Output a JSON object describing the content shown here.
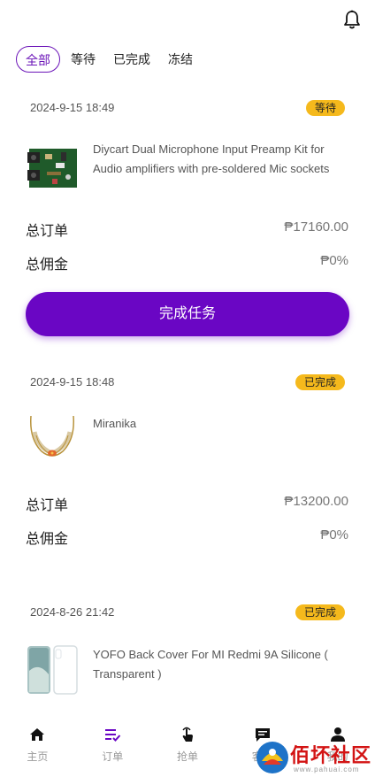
{
  "tabs": [
    {
      "label": "全部",
      "active": true
    },
    {
      "label": "等待",
      "active": false
    },
    {
      "label": "已完成",
      "active": false
    },
    {
      "label": "冻结",
      "active": false
    }
  ],
  "orders": [
    {
      "date": "2024-9-15 18:49",
      "status": "等待",
      "product_name": "Diycart Dual Microphone Input Preamp Kit for Audio amplifiers with pre-soldered Mic sockets",
      "total_order_label": "总订单",
      "total_order_value": "₱17160.00",
      "commission_label": "总佣金",
      "commission_value": "₱0%",
      "action_label": "完成任务"
    },
    {
      "date": "2024-9-15 18:48",
      "status": "已完成",
      "product_name": "Miranika",
      "total_order_label": "总订单",
      "total_order_value": "₱13200.00",
      "commission_label": "总佣金",
      "commission_value": "₱0%"
    },
    {
      "date": "2024-8-26 21:42",
      "status": "已完成",
      "product_name": "YOFO Back Cover For MI Redmi 9A Silicone ( Transparent )"
    }
  ],
  "bottom_nav": [
    {
      "label": "主页",
      "icon": "home-icon"
    },
    {
      "label": "订单",
      "icon": "list-check-icon"
    },
    {
      "label": "抢单",
      "icon": "hand-tap-icon"
    },
    {
      "label": "客服",
      "icon": "chat-icon"
    },
    {
      "label": "我的",
      "icon": "user-icon"
    }
  ],
  "watermark": {
    "text": "佰坏社区",
    "url": "www.pahuai.com"
  },
  "colors": {
    "accent": "#6a06c4",
    "badge": "#f5b91c"
  }
}
